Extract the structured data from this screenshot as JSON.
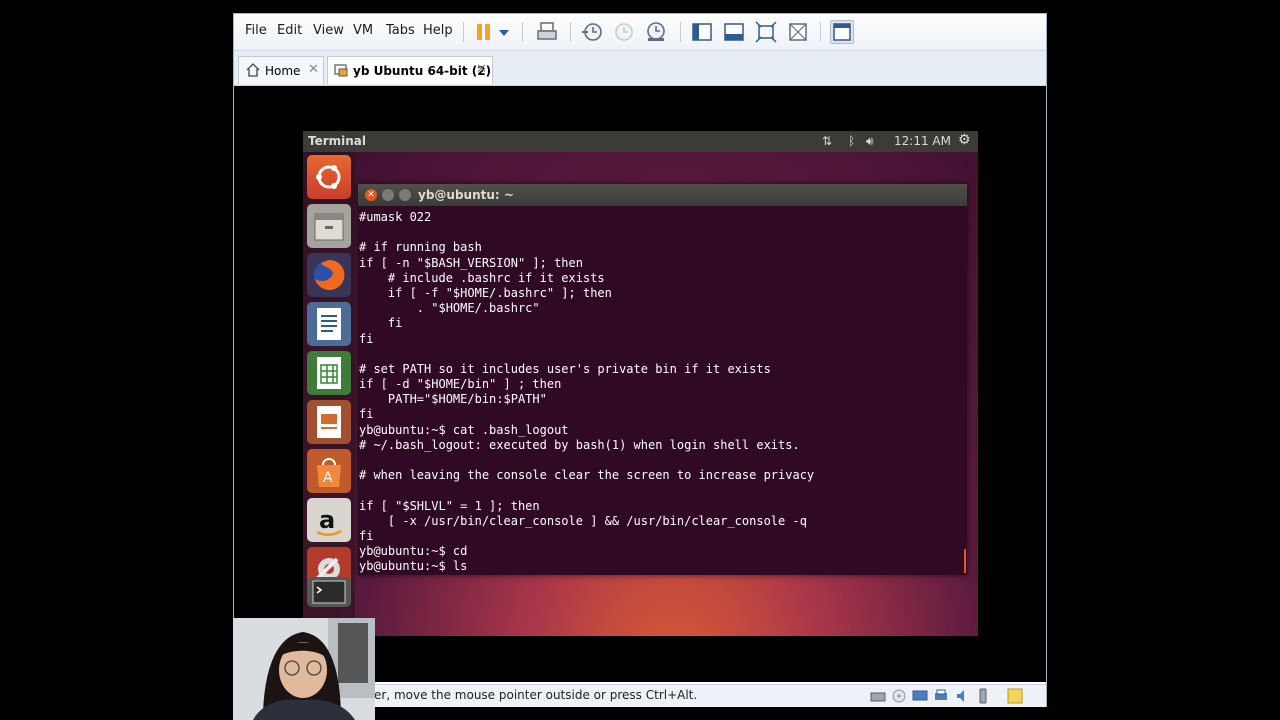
{
  "menu": [
    "File",
    "Edit",
    "View",
    "VM",
    "Tabs",
    "Help"
  ],
  "toolbar": {
    "icons": [
      "pause-icon",
      "dropdown-arrow-icon",
      "send-ctrl-alt-del-icon",
      "snapshot-icon",
      "revert-snapshot-icon",
      "snapshot-manager-icon",
      "show-library-icon",
      "thumbnail-icon",
      "full-screen-icon",
      "unity-icon",
      "console-view-icon"
    ]
  },
  "tabs": [
    {
      "label": "Home",
      "active": false
    },
    {
      "label": "yb Ubuntu 64-bit (2)",
      "active": true
    }
  ],
  "ubuntu_panel": {
    "title": "Terminal",
    "clock": "12:11 AM"
  },
  "terminal": {
    "title": "yb@ubuntu: ~",
    "lines": [
      "#umask 022",
      "",
      "# if running bash",
      "if [ -n \"$BASH_VERSION\" ]; then",
      "    # include .bashrc if it exists",
      "    if [ -f \"$HOME/.bashrc\" ]; then",
      "        . \"$HOME/.bashrc\"",
      "    fi",
      "fi",
      "",
      "# set PATH so it includes user's private bin if it exists",
      "if [ -d \"$HOME/bin\" ] ; then",
      "    PATH=\"$HOME/bin:$PATH\"",
      "fi",
      "yb@ubuntu:~$ cat .bash_logout",
      "# ~/.bash_logout: executed by bash(1) when login shell exits.",
      "",
      "# when leaving the console clear the screen to increase privacy",
      "",
      "if [ \"$SHLVL\" = 1 ]; then",
      "    [ -x /usr/bin/clear_console ] && /usr/bin/clear_console -q",
      "fi",
      "yb@ubuntu:~$ cd",
      "yb@ubuntu:~$ ls"
    ]
  },
  "launcher": [
    "ubuntu-dash-icon",
    "files-icon",
    "firefox-icon",
    "writer-icon",
    "calc-icon",
    "impress-icon",
    "software-center-icon",
    "amazon-icon",
    "system-settings-icon",
    "terminal-launcher-icon"
  ],
  "status": {
    "text": "er, move the mouse pointer outside or press Ctrl+Alt."
  },
  "colors": {
    "terminal_bg": "#300a24",
    "ubuntu_orange": "#e95420",
    "panel": "#3c3b37"
  }
}
